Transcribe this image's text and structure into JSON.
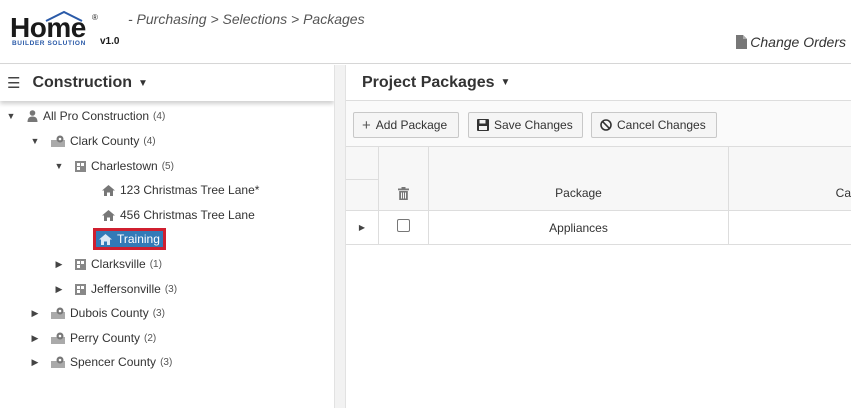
{
  "header": {
    "logo_word": "Home",
    "logo_sub": "BUILDER SOLUTION",
    "logo_reg": "®",
    "version": "v1.0",
    "breadcrumb": "- Purchasing > Selections > Packages",
    "change_orders": "Change Orders"
  },
  "left": {
    "title": "Construction",
    "tree": [
      {
        "label": "All Pro Construction",
        "count": "(4)",
        "icon": "person-icon",
        "toggle": "expanded"
      },
      {
        "label": "Clark County",
        "count": "(4)",
        "icon": "map-pin-icon",
        "toggle": "expanded"
      },
      {
        "label": "Charlestown",
        "count": "(5)",
        "icon": "city-icon",
        "toggle": "expanded"
      },
      {
        "label": "123 Christmas Tree Lane*",
        "count": "",
        "icon": "house-icon",
        "toggle": "none"
      },
      {
        "label": "456 Christmas Tree Lane",
        "count": "",
        "icon": "house-icon",
        "toggle": "none"
      },
      {
        "label": "Training",
        "count": "",
        "icon": "house-icon",
        "toggle": "none",
        "selected": true
      },
      {
        "label": "Clarksville",
        "count": "(1)",
        "icon": "city-icon",
        "toggle": "collapsed"
      },
      {
        "label": "Jeffersonville",
        "count": "(3)",
        "icon": "city-icon",
        "toggle": "collapsed"
      },
      {
        "label": "Dubois County",
        "count": "(3)",
        "icon": "map-pin-icon",
        "toggle": "collapsed"
      },
      {
        "label": "Perry County",
        "count": "(2)",
        "icon": "map-pin-icon",
        "toggle": "collapsed"
      },
      {
        "label": "Spencer County",
        "count": "(3)",
        "icon": "map-pin-icon",
        "toggle": "collapsed"
      }
    ]
  },
  "right": {
    "title": "Project Packages",
    "toolbar": {
      "add": "Add Package",
      "save": "Save Changes",
      "cancel": "Cancel Changes"
    },
    "grid": {
      "columns": [
        "",
        "",
        "Package",
        "Ca"
      ],
      "rows": [
        {
          "package": "Appliances",
          "checked": false
        }
      ]
    }
  },
  "colors": {
    "selected_bg": "#337ab7",
    "selected_outline": "#d01f2f",
    "logo_blue": "#2a5aa8"
  }
}
